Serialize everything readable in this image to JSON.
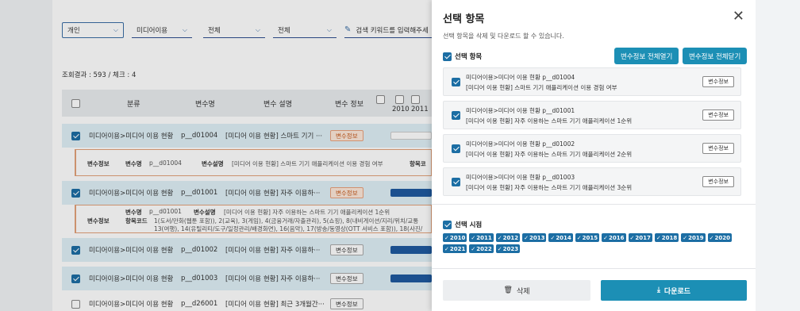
{
  "filters": {
    "type": "개인",
    "category": "미디어이용",
    "sub1": "전체",
    "sub2": "전체",
    "search_text": "검색 키워드를 입력해주세"
  },
  "result_count": "조회결과 : 593  /  체크 : 4",
  "table": {
    "headers": [
      "분류",
      "변수명",
      "변수 설명",
      "변수 정보"
    ],
    "year_headers": [
      "2010",
      "2011"
    ]
  },
  "rows": [
    {
      "category": "미디어이용>미디어 이용 현황",
      "var": "p__d01004",
      "desc": "[미디어 이용 현황] 스마트 기기 ···",
      "badge": "변수정보",
      "checked": true
    },
    {
      "category": "미디어이용>미디어 이용 현황",
      "var": "p__d01001",
      "desc": "[미디어 이용 현황] 자주 이용하···",
      "badge": "변수정보",
      "checked": true
    },
    {
      "category": "미디어이용>미디어 이용 현황",
      "var": "p__d01002",
      "desc": "[미디어 이용 현황] 자주 이용하···",
      "badge": "변수정보",
      "checked": true
    },
    {
      "category": "미디어이용>미디어 이용 현황",
      "var": "p__d01003",
      "desc": "[미디어 이용 현황] 자주 이용하···",
      "badge": "변수정보",
      "checked": true
    },
    {
      "category": "미디어이용>미디어 이용 현황",
      "var": "p__d26001",
      "desc": "[미디어 이용 현황] 최근 3개월간···",
      "badge": "변수정보",
      "checked": false
    }
  ],
  "detail1": {
    "label": "변수정보",
    "name_label": "변수명",
    "name": "p__d01004",
    "desc_label": "변수설명",
    "desc": "[미디어 이용 현황] 스마트 기기 애플리케이션 이용 경험 여부",
    "code_label": "항목코"
  },
  "detail2": {
    "label": "변수정보",
    "name_label": "변수명",
    "name": "p__d01001",
    "desc_label": "변수설명",
    "desc": "[미디어 이용 현황] 자주 이용하는 스마트 기기 애플리케이션 1순위",
    "code_label": "항목코드",
    "code_line1": "1(도서/만화(웹툰 포함)), 2(교육), 3(게임), 4(금융거래/자출관리), 5(쇼핑), 8(내비게이션/지리/위치/교통",
    "code_line2": "13(여행), 14(유틸리티/도구/일정관리/배경화면), 16(음악), 17(방송/동영상(OTT 서비스 포함)), 18(사진/"
  },
  "panel": {
    "title": "선택 항목",
    "description": "선택 항목을 삭제 및 다운로드 할 수 있습니다.",
    "items_label": "선택 항목",
    "expand_all": "변수정보 전체열기",
    "collapse_all": "변수정보 전체닫기",
    "items": [
      {
        "line1": "미디어이용>미디어 이용 현황     p__d01004",
        "line2": "[미디어 이용 현황] 스마트 기기 애플리케이션 이용 경험 여부",
        "button": "변수정보"
      },
      {
        "line1": "미디어이용>미디어 이용 현황     p__d01001",
        "line2": "[미디어 이용 현황] 자주 이용하는 스마트 기기 애플리케이션 1순위",
        "button": "변수정보"
      },
      {
        "line1": "미디어이용>미디어 이용 현황     p__d01002",
        "line2": "[미디어 이용 현황] 자주 이용하는 스마트 기기 애플리케이션 2순위",
        "button": "변수정보"
      },
      {
        "line1": "미디어이용>미디어 이용 현황     p__d01003",
        "line2": "[미디어 이용 현황] 자주 이용하는 스마트 기기 애플리케이션 3순위",
        "button": "변수정보"
      }
    ],
    "years_label": "선택 시점",
    "years": [
      "2010",
      "2011",
      "2012",
      "2013",
      "2014",
      "2015",
      "2016",
      "2017",
      "2018",
      "2019",
      "2020",
      "2021",
      "2022",
      "2023"
    ],
    "delete": "삭제",
    "download": "다운로드"
  },
  "colors": {
    "accent": "#1c8fb5",
    "check": "#1c6ea4",
    "badge": "#e9a27d"
  }
}
